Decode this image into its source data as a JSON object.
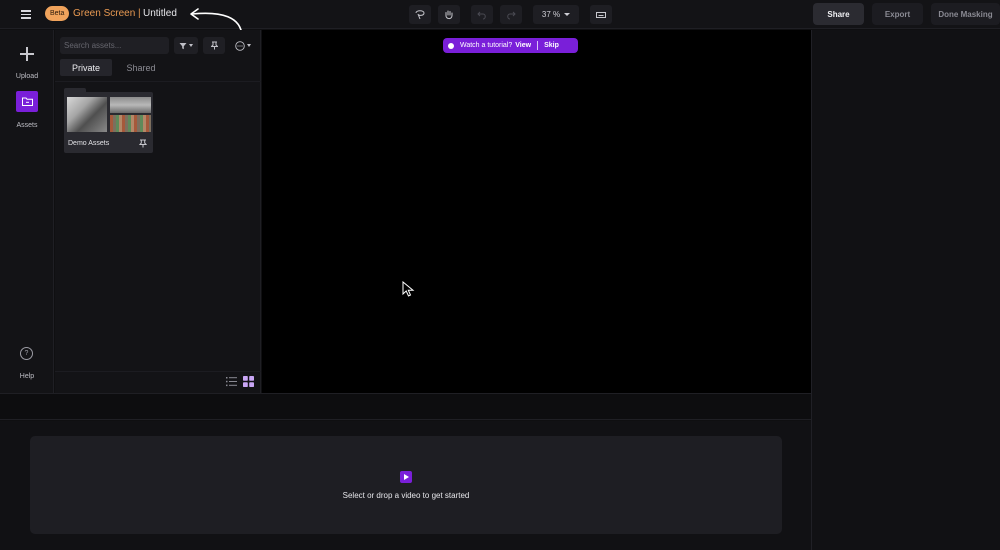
{
  "header": {
    "beta_label": "Beta",
    "app_title": "Green Screen |",
    "document_title": "Untitled",
    "zoom_level": "37 %",
    "share_label": "Share",
    "export_label": "Export",
    "done_label": "Done Masking",
    "tools": [
      "lasso-icon",
      "hand-icon",
      "undo-icon",
      "redo-icon",
      "keyboard-icon"
    ]
  },
  "sidebar": {
    "items": [
      {
        "label": "Upload",
        "icon": "plus-icon"
      },
      {
        "label": "Assets",
        "icon": "folder-icon",
        "active": true
      },
      {
        "label": "Help",
        "icon": "help-icon"
      }
    ]
  },
  "assets_panel": {
    "search_placeholder": "Search assets...",
    "tabs": [
      {
        "label": "Private",
        "active": true
      },
      {
        "label": "Shared",
        "active": false
      }
    ],
    "folders": [
      {
        "name": "Demo Assets",
        "pinned": true
      }
    ],
    "view_mode": "grid"
  },
  "canvas": {
    "tutorial": {
      "text": "Watch a tutorial?",
      "view_label": "View",
      "skip_label": "Skip"
    }
  },
  "timeline": {
    "empty_text": "Select or drop a video to get started"
  },
  "colors": {
    "accent": "#7a1fd9",
    "beta_badge": "#f0a35c",
    "app_title": "#e99a52",
    "background": "#0f0f11",
    "canvas": "#000000"
  }
}
